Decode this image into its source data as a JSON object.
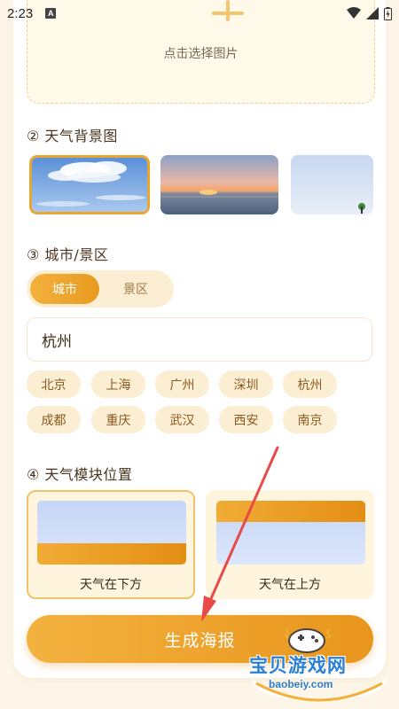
{
  "status": {
    "time": "2:23",
    "notif_letter": "A"
  },
  "upload": {
    "label": "点击选择图片"
  },
  "sections": {
    "background": "② 天气背景图",
    "city": "③ 城市/景区",
    "position": "④ 天气模块位置"
  },
  "toggle": {
    "city": "城市",
    "scenic": "景区",
    "selected": "城市"
  },
  "city_input": {
    "value": "杭州"
  },
  "chips": [
    "北京",
    "上海",
    "广州",
    "深圳",
    "杭州",
    "成都",
    "重庆",
    "武汉",
    "西安",
    "南京"
  ],
  "layout": {
    "bottom": "天气在下方",
    "top": "天气在上方",
    "selected": "天气在下方"
  },
  "generate_button": "生成海报",
  "watermark": {
    "title": "宝贝游戏网",
    "url": "baobeiy.com"
  },
  "colors": {
    "accent": "#e9a531",
    "chip_bg": "#fbeed2",
    "watermark": "#2c7fd6",
    "arrow": "#e84a4a"
  }
}
